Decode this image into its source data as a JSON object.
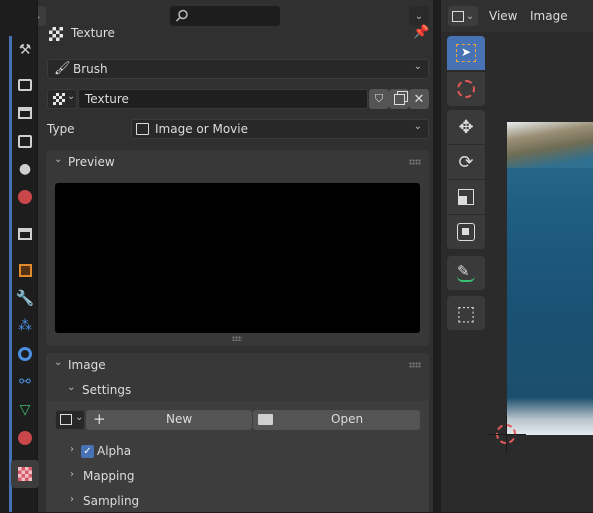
{
  "left_editor": {
    "title": "Texture",
    "brush_label": "Brush",
    "texture_name": "Texture",
    "type_label": "Type",
    "type_value": "Image or Movie"
  },
  "panels": {
    "preview": "Preview",
    "image": "Image",
    "settings": "Settings",
    "new_label": "New",
    "open_label": "Open",
    "alpha_label": "Alpha",
    "alpha_checked": true,
    "mapping_label": "Mapping",
    "sampling_label": "Sampling"
  },
  "image_editor": {
    "menu_view": "View",
    "menu_image": "Image"
  },
  "colors": {
    "accent": "#4772b3",
    "panel_bg": "#383838",
    "window_bg": "#303030"
  },
  "icons": [
    "editor-type-icon",
    "search-icon",
    "pin-icon",
    "texture-icon",
    "brush-icon",
    "fake-user-icon",
    "duplicate-icon",
    "unlink-icon",
    "image-icon",
    "plus-icon",
    "folder-icon",
    "select-box-icon",
    "cursor-icon",
    "move-icon",
    "rotate-icon",
    "scale-icon",
    "transform-icon",
    "annotate-icon",
    "sample-icon"
  ]
}
